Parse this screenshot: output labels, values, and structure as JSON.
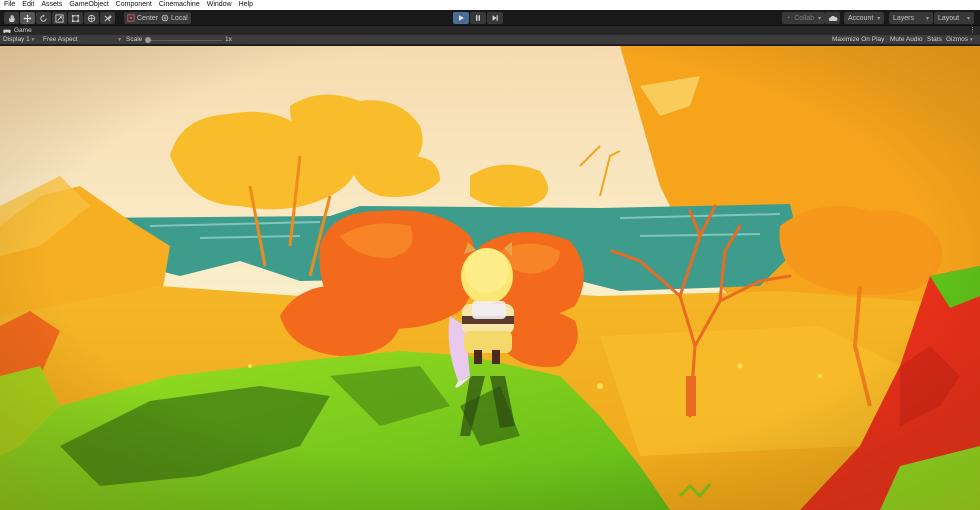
{
  "menu": [
    "File",
    "Edit",
    "Assets",
    "GameObject",
    "Component",
    "Cinemachine",
    "Window",
    "Help"
  ],
  "toolbar": {
    "tools": [
      {
        "name": "hand-tool-icon",
        "active": false
      },
      {
        "name": "move-tool-icon",
        "active": true
      },
      {
        "name": "rotate-tool-icon",
        "active": false
      },
      {
        "name": "scale-tool-icon",
        "active": false
      },
      {
        "name": "rect-tool-icon",
        "active": false
      },
      {
        "name": "transform-tool-icon",
        "active": false
      },
      {
        "name": "custom-tool-icon",
        "active": false
      }
    ],
    "pivot_label": "Center",
    "space_label": "Local",
    "collab_label": "Collab",
    "account_label": "Account",
    "layers_label": "Layers",
    "layout_label": "Layout"
  },
  "tab": {
    "title": "Game",
    "menu_glyph": "⋮"
  },
  "gameview": {
    "display_label": "Display 1",
    "aspect_label": "Free Aspect",
    "scale_label": "Scale",
    "scale_value": "1x",
    "scale_fraction": 0.0,
    "maximize_label": "Maximize On Play",
    "mute_label": "Mute Audio",
    "stats_label": "Stats",
    "gizmos_label": "Gizmos"
  },
  "colors": {
    "play_active": "#4a6d96",
    "sky": "#f8ecc4",
    "ground": "#f3a51a",
    "grass": "#7fd21c",
    "water": "#3e9c8c",
    "foliage": "#f36a1c"
  }
}
